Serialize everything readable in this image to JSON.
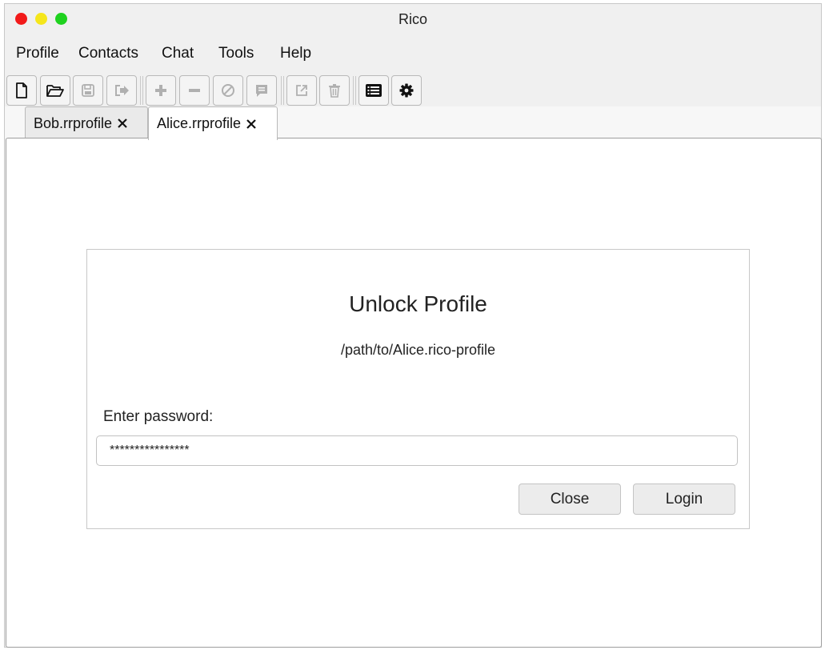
{
  "window": {
    "title": "Rico",
    "controls": [
      "close",
      "minimize",
      "maximize"
    ]
  },
  "menubar": {
    "items": [
      "Profile",
      "Contacts",
      "Chat",
      "Tools",
      "Help"
    ]
  },
  "toolbar": {
    "buttons": [
      {
        "icon": "new-file-icon",
        "enabled": true
      },
      {
        "icon": "open-folder-icon",
        "enabled": true
      },
      {
        "icon": "save-icon",
        "enabled": false
      },
      {
        "icon": "logout-icon",
        "enabled": false
      },
      {
        "icon": "plus-icon",
        "enabled": false
      },
      {
        "icon": "minus-icon",
        "enabled": false
      },
      {
        "icon": "block-icon",
        "enabled": false
      },
      {
        "icon": "message-icon",
        "enabled": false
      },
      {
        "icon": "external-link-icon",
        "enabled": false
      },
      {
        "icon": "trash-icon",
        "enabled": false
      },
      {
        "icon": "list-icon",
        "enabled": true
      },
      {
        "icon": "gear-icon",
        "enabled": true
      }
    ]
  },
  "tabs": [
    {
      "label": "Bob.rrprofile",
      "active": false
    },
    {
      "label": "Alice.rrprofile",
      "active": true
    }
  ],
  "dialog": {
    "title": "Unlock Profile",
    "path": "/path/to/Alice.rico-profile",
    "password_label": "Enter password:",
    "password_value": "****************",
    "close_label": "Close",
    "login_label": "Login"
  },
  "colors": {
    "traffic_red": "#f21a1a",
    "traffic_yellow": "#f5e61b",
    "traffic_green": "#1fd21f"
  }
}
